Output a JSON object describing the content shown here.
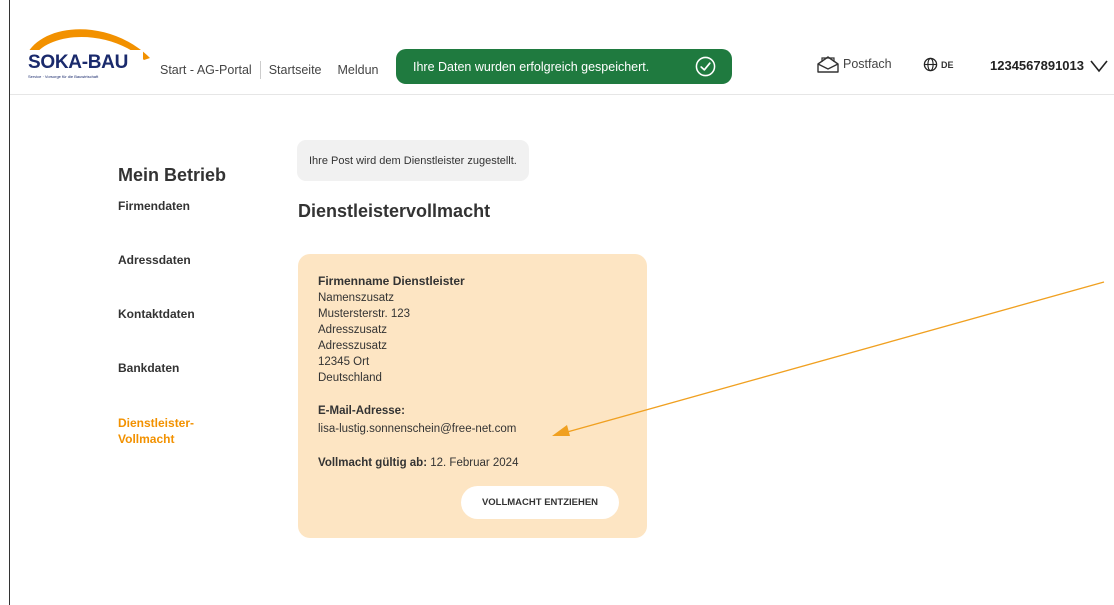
{
  "header": {
    "logo_text": "SOKA-BAU",
    "logo_tagline": "Service · Vorsorge für die Bauwirtschaft",
    "nav": [
      "Start - AG-Portal",
      "Startseite",
      "Meldun"
    ],
    "postfach_label": "Postfach",
    "language": "DE",
    "account_number": "1234567891013"
  },
  "toast": {
    "message": "Ihre Daten wurden erfolgreich gespeichert."
  },
  "sidebar": {
    "title": "Mein Betrieb",
    "items": [
      {
        "label": "Firmendaten"
      },
      {
        "label": "Adressdaten"
      },
      {
        "label": "Kontaktdaten"
      },
      {
        "label": "Bankdaten"
      },
      {
        "label_line1": "Dienstleister-",
        "label_line2": "Vollmacht",
        "active": true
      }
    ]
  },
  "main": {
    "info_text": "Ihre Post wird dem Dienstleister zugestellt.",
    "title": "Dienstleistervollmacht",
    "card": {
      "company": "Firmenname Dienstleister",
      "address_lines": [
        "Namenszusatz",
        "Mustersterstr. 123",
        "Adresszusatz",
        "Adresszusatz",
        "12345 Ort",
        "Deutschland"
      ],
      "email_label": "E-Mail-Adresse:",
      "email": "lisa-lustig.sonnenschein@free-net.com",
      "valid_label": "Vollmacht gültig ab:",
      "valid_date": "12. Februar 2024",
      "revoke_button": "VOLLMACHT ENTZIEHEN"
    }
  },
  "colors": {
    "brand_blue": "#1a2a6c",
    "accent_orange": "#f29100",
    "toast_green": "#1f7a3f",
    "card_bg": "#fde5c3",
    "annotation_line": "#f0a020"
  },
  "icons": [
    "check-circle-icon",
    "postfach-icon",
    "globe-icon",
    "chevron-down-icon"
  ]
}
